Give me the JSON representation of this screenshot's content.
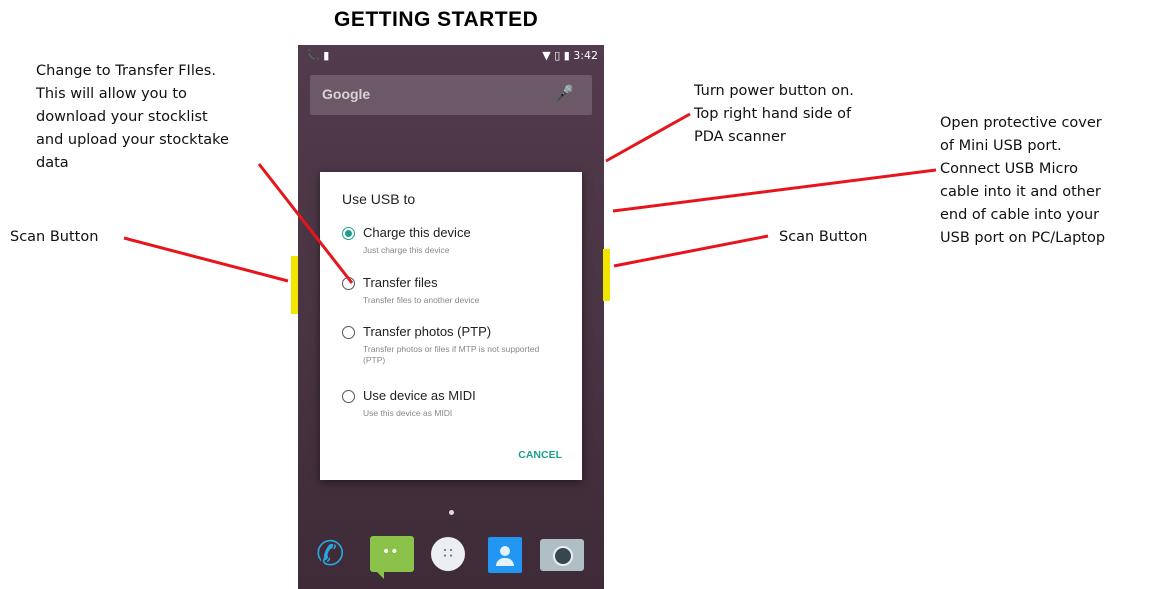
{
  "title": "GETTING STARTED",
  "annotations": {
    "transfer": "Change to Transfer FIles.\nThis will allow you to\ndownload your stocklist\nand upload your stocktake\ndata",
    "power": "Turn power button on.\nTop right hand side of\nPDA scanner",
    "usb": "Open protective cover\nof Mini USB port.\nConnect USB Micro\ncable into it and other\nend of cable into your\nUSB port on PC/Laptop",
    "scan_left": "Scan Button",
    "scan_right": "Scan Button"
  },
  "phone": {
    "status": {
      "left_icons": "📞 ▮",
      "time": "3:42",
      "right_icons": "▼ ▯ ▮"
    },
    "search": {
      "logo": "Google",
      "mic": "🎤"
    },
    "dialog": {
      "title": "Use USB to",
      "options": [
        {
          "label": "Charge this device",
          "sub": "Just charge this device",
          "checked": true
        },
        {
          "label": "Transfer files",
          "sub": "Transfer files to another device",
          "checked": false
        },
        {
          "label": "Transfer photos (PTP)",
          "sub": "Transfer photos or files if MTP is not supported (PTP)",
          "checked": false
        },
        {
          "label": "Use device as MIDI",
          "sub": "Use this device as MIDI",
          "checked": false
        }
      ],
      "cancel": "CANCEL"
    },
    "dock": [
      "phone-icon",
      "messaging-icon",
      "apps-icon",
      "contacts-icon",
      "camera-icon"
    ]
  },
  "colors": {
    "accent": "#1e9f8e",
    "annotation_line": "#e8141c",
    "scan_button": "#f2e600"
  }
}
